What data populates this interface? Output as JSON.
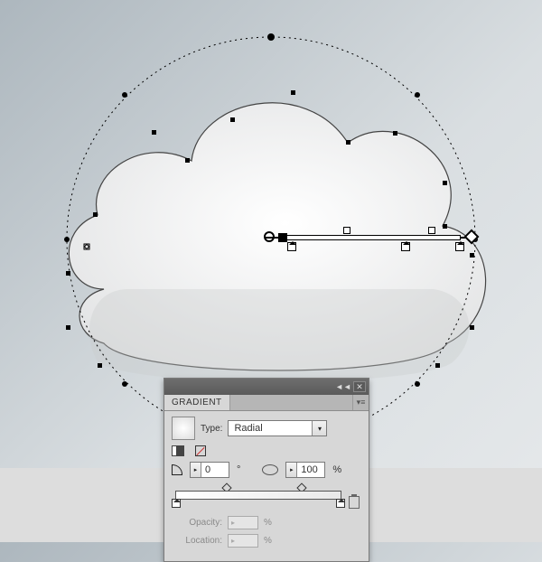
{
  "panel": {
    "title": "GRADIENT",
    "type_label": "Type:",
    "type_value": "Radial",
    "angle_value": "0",
    "angle_unit": "°",
    "aspect_value": "100",
    "aspect_unit": "%",
    "opacity_label": "Opacity:",
    "opacity_unit": "%",
    "location_label": "Location:",
    "location_unit": "%"
  },
  "chart_data": {
    "type": "radial-gradient",
    "angle_deg": 0,
    "aspect_ratio_pct": 100,
    "stops": [
      {
        "position_pct": 0,
        "color": "#ffffff"
      },
      {
        "position_pct": 100,
        "color": "#e9e9e9"
      }
    ],
    "midpoints_pct": [
      30,
      75
    ]
  }
}
